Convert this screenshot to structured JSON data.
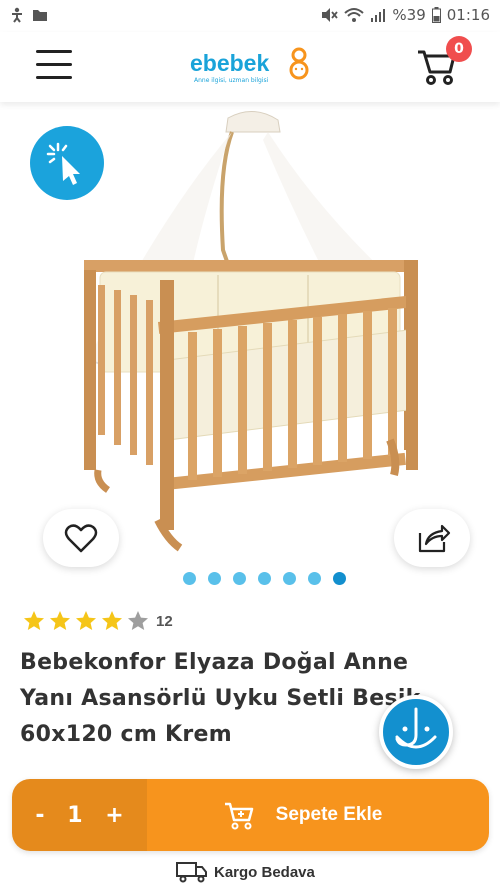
{
  "status_bar": {
    "battery_text": "%39",
    "time": "01:16"
  },
  "header": {
    "logo_text": "ebebek",
    "logo_tagline": "Anne ilgisi, uzman bilgisi",
    "cart_count": "0"
  },
  "gallery": {
    "image_subject": "Wooden crib with canopy and cream bedding",
    "dot_count": 7,
    "active_dot": 7
  },
  "product": {
    "rating": 4,
    "rating_max": 5,
    "review_count": "12",
    "title_line1": "Bebekonfor Elyaza Doğal Anne",
    "title_line2": "Yanı Asansörlü Uyku Setli Beşik",
    "title_line3": "60x120 cm Krem"
  },
  "cart_bar": {
    "minus_label": "-",
    "quantity": "1",
    "plus_label": "+",
    "add_to_cart_label": "Sepete Ekle"
  },
  "shipping": {
    "label": "Kargo Bedava"
  },
  "colors": {
    "brand_blue": "#1aa3d9",
    "orange": "#f7941d",
    "orange_dark": "#e58a1c",
    "badge_red": "#f04e4e",
    "star_yellow": "#f5c518"
  }
}
